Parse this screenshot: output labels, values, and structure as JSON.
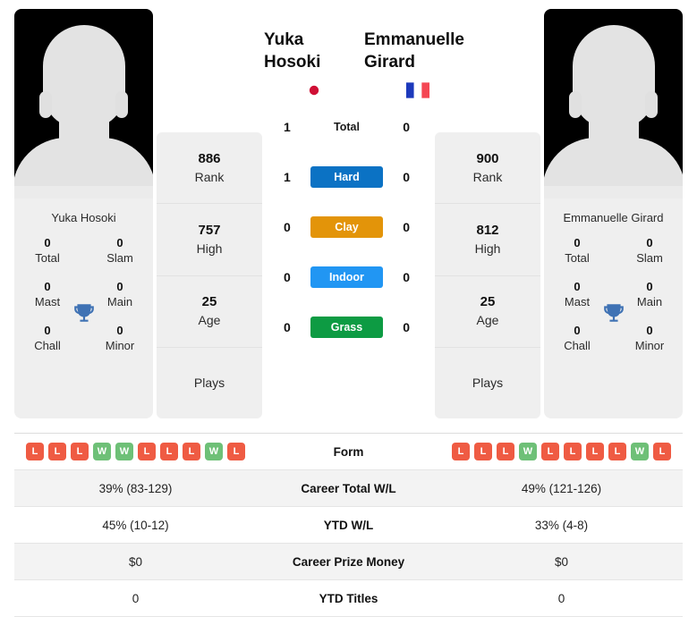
{
  "colors": {
    "hard": "#0b72c4",
    "clay": "#e39409",
    "indoor": "#2196f3",
    "grass": "#0d9b43",
    "win": "#6ec077",
    "loss": "#ef5b43",
    "trophy": "#3f72b4"
  },
  "players": {
    "left": {
      "name": "Yuka Hosoki",
      "name_small": "Yuka Hosoki",
      "flag": "jp-flag-icon",
      "flag_name": "Japan",
      "titles": [
        {
          "value": "0",
          "label": "Total"
        },
        {
          "value": "0",
          "label": "Slam"
        },
        {
          "value": "0",
          "label": "Mast"
        },
        {
          "value": "0",
          "label": "Main"
        },
        {
          "value": "0",
          "label": "Chall"
        },
        {
          "value": "0",
          "label": "Minor"
        }
      ],
      "stats": [
        {
          "value": "886",
          "label": "Rank"
        },
        {
          "value": "757",
          "label": "High"
        },
        {
          "value": "25",
          "label": "Age"
        },
        {
          "value": "",
          "label": "Plays"
        }
      ]
    },
    "right": {
      "name": "Emmanuelle Girard",
      "name_small": "Emmanuelle Girard",
      "flag": "fr-flag-icon",
      "flag_name": "France",
      "titles": [
        {
          "value": "0",
          "label": "Total"
        },
        {
          "value": "0",
          "label": "Slam"
        },
        {
          "value": "0",
          "label": "Mast"
        },
        {
          "value": "0",
          "label": "Main"
        },
        {
          "value": "0",
          "label": "Chall"
        },
        {
          "value": "0",
          "label": "Minor"
        }
      ],
      "stats": [
        {
          "value": "900",
          "label": "Rank"
        },
        {
          "value": "812",
          "label": "High"
        },
        {
          "value": "25",
          "label": "Age"
        },
        {
          "value": "",
          "label": "Plays"
        }
      ]
    }
  },
  "h2h": [
    {
      "label": "Total",
      "left": "1",
      "right": "0",
      "style": "plain"
    },
    {
      "label": "Hard",
      "left": "1",
      "right": "0",
      "style": "hard"
    },
    {
      "label": "Clay",
      "left": "0",
      "right": "0",
      "style": "clay"
    },
    {
      "label": "Indoor",
      "left": "0",
      "right": "0",
      "style": "indoor"
    },
    {
      "label": "Grass",
      "left": "0",
      "right": "0",
      "style": "grass"
    }
  ],
  "table": {
    "rows": [
      {
        "label": "Form",
        "type": "form",
        "left_form": [
          "L",
          "L",
          "L",
          "W",
          "W",
          "L",
          "L",
          "L",
          "W",
          "L"
        ],
        "right_form": [
          "L",
          "L",
          "L",
          "W",
          "L",
          "L",
          "L",
          "L",
          "W",
          "L"
        ]
      },
      {
        "label": "Career Total W/L",
        "type": "text",
        "left": "39% (83-129)",
        "right": "49% (121-126)"
      },
      {
        "label": "YTD W/L",
        "type": "text",
        "left": "45% (10-12)",
        "right": "33% (4-8)"
      },
      {
        "label": "Career Prize Money",
        "type": "text",
        "left": "$0",
        "right": "$0"
      },
      {
        "label": "YTD Titles",
        "type": "text",
        "left": "0",
        "right": "0"
      }
    ]
  }
}
